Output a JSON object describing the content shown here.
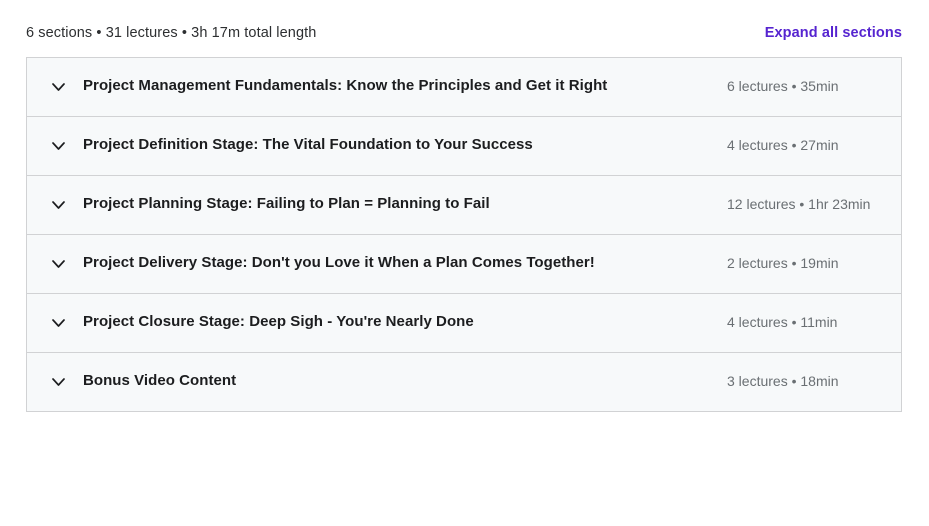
{
  "header": {
    "summary": "6 sections • 31 lectures • 3h 17m total length",
    "expand_label": "Expand all sections",
    "accent_color": "#5624d0"
  },
  "colors": {
    "row_background": "#f7f9fa",
    "border": "#d1d2d4",
    "title_text": "#1c1d1f",
    "meta_text": "#6a6f73",
    "summary_text": "#2d2f31"
  },
  "curriculum": {
    "sections": [
      {
        "title": "Project Management Fundamentals: Know the Principles and Get it Right",
        "meta": "6 lectures • 35min",
        "toggle_icon": "chevron-down-icon"
      },
      {
        "title": "Project Definition Stage: The Vital Foundation to Your Success",
        "meta": "4 lectures • 27min",
        "toggle_icon": "chevron-down-icon"
      },
      {
        "title": "Project Planning Stage: Failing to Plan = Planning to Fail",
        "meta": "12 lectures • 1hr 23min",
        "toggle_icon": "chevron-down-icon"
      },
      {
        "title": "Project Delivery Stage: Don't you Love it When a Plan Comes Together!",
        "meta": "2 lectures • 19min",
        "toggle_icon": "chevron-down-icon"
      },
      {
        "title": "Project Closure Stage: Deep Sigh - You're Nearly Done",
        "meta": "4 lectures • 11min",
        "toggle_icon": "chevron-down-icon"
      },
      {
        "title": "Bonus Video Content",
        "meta": "3 lectures • 18min",
        "toggle_icon": "chevron-down-icon"
      }
    ]
  }
}
